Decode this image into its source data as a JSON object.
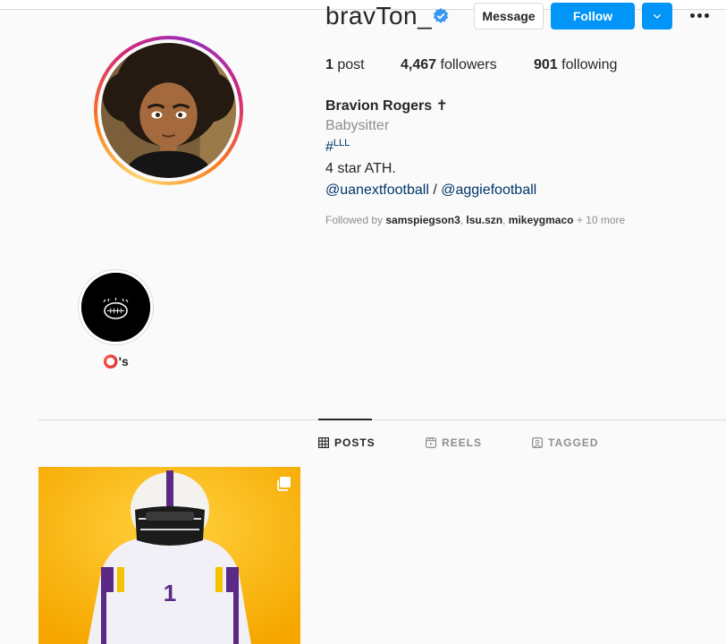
{
  "profile": {
    "username": "bravTon_",
    "full_name": "Bravion Rogers ✝",
    "category": "Babysitter",
    "hashtag_symbol": "#",
    "hashtag_text": "LLL",
    "bio": "4 star ATH.",
    "mention_1": "@uanextfootball",
    "mention_sep": " / ",
    "mention_2": "@aggiefootball"
  },
  "actions": {
    "message_label": "Message",
    "follow_label": "Follow",
    "suggest_icon": "chevron-down-icon",
    "more_icon": "more-icon"
  },
  "stats": {
    "posts_count": "1",
    "posts_label": " post",
    "followers_count": "4,467",
    "followers_label": " followers",
    "following_count": "901",
    "following_label": " following"
  },
  "followed_by": {
    "prefix": "Followed by ",
    "names": [
      "samspiegson3",
      "lsu.szn",
      "mikeygmaco"
    ],
    "sep": ", ",
    "more": " + 10 more"
  },
  "highlights": [
    {
      "label": "⭕'s"
    }
  ],
  "tabs": [
    {
      "label": "POSTS",
      "icon": "grid-icon",
      "active": true
    },
    {
      "label": "REELS",
      "icon": "reels-icon",
      "active": false
    },
    {
      "label": "TAGGED",
      "icon": "tagged-icon",
      "active": false
    }
  ],
  "colors": {
    "accent": "#0095f6",
    "link": "#00376b",
    "post_background": "#ffb300"
  }
}
